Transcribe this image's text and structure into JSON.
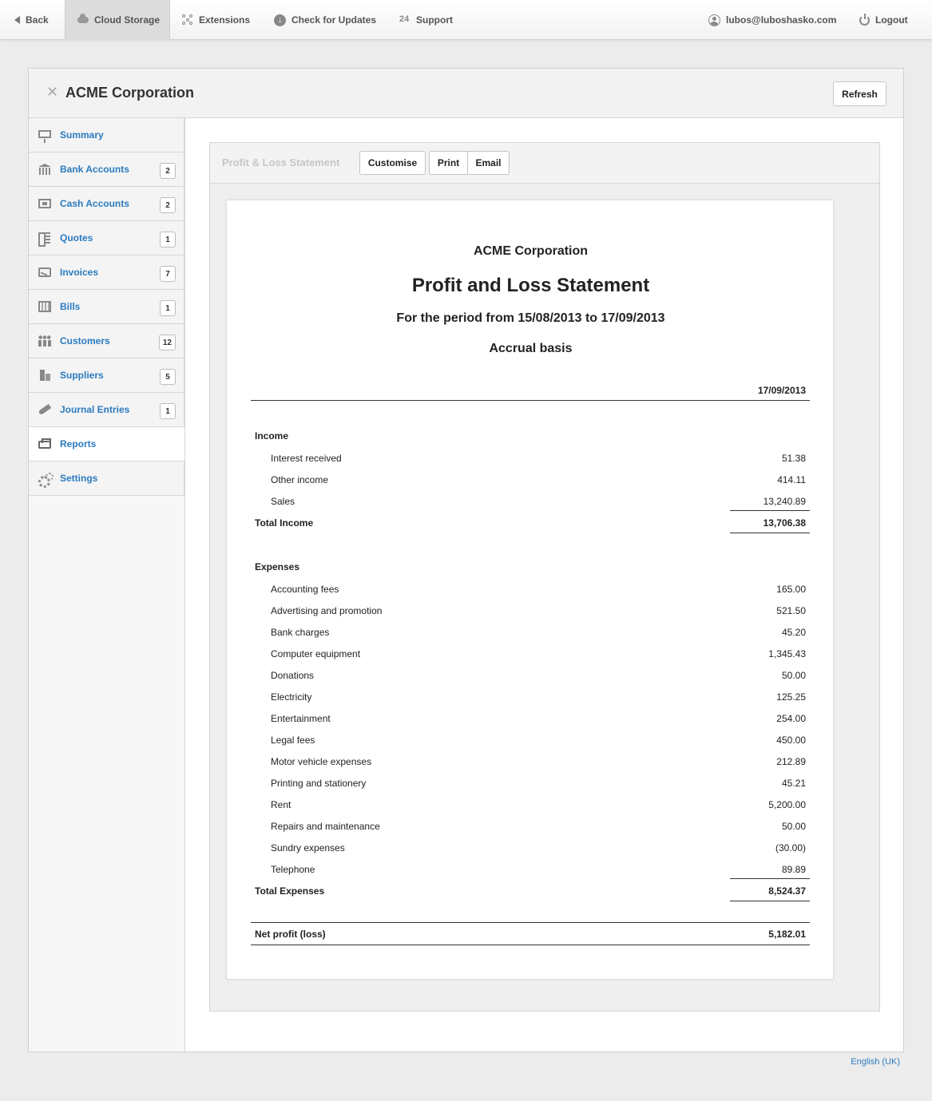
{
  "topbar": {
    "back": "Back",
    "cloud_storage": "Cloud Storage",
    "extensions": "Extensions",
    "check_updates": "Check for Updates",
    "support": "Support",
    "support_icon_text": "24",
    "user": "lubos@luboshasko.com",
    "logout": "Logout"
  },
  "header": {
    "company": "ACME Corporation",
    "close": "✕",
    "refresh": "Refresh"
  },
  "sidebar": {
    "items": [
      {
        "label": "Summary",
        "badge": null,
        "icon": "summary-icon"
      },
      {
        "label": "Bank Accounts",
        "badge": "2",
        "icon": "bank-icon"
      },
      {
        "label": "Cash Accounts",
        "badge": "2",
        "icon": "cash-register-icon"
      },
      {
        "label": "Quotes",
        "badge": "1",
        "icon": "quotes-icon"
      },
      {
        "label": "Invoices",
        "badge": "7",
        "icon": "invoice-icon"
      },
      {
        "label": "Bills",
        "badge": "1",
        "icon": "calendar-icon"
      },
      {
        "label": "Customers",
        "badge": "12",
        "icon": "people-icon"
      },
      {
        "label": "Suppliers",
        "badge": "5",
        "icon": "building-icon"
      },
      {
        "label": "Journal Entries",
        "badge": "1",
        "icon": "quill-icon"
      },
      {
        "label": "Reports",
        "badge": null,
        "icon": "printer-icon"
      },
      {
        "label": "Settings",
        "badge": null,
        "icon": "gears-icon"
      }
    ],
    "active": "Reports"
  },
  "report_toolbar": {
    "breadcrumb": "Profit & Loss Statement",
    "customise": "Customise",
    "print": "Print",
    "email": "Email"
  },
  "report": {
    "company": "ACME Corporation",
    "title": "Profit and Loss Statement",
    "period": "For the period from 15/08/2013 to 17/09/2013",
    "basis": "Accrual basis",
    "column_date": "17/09/2013",
    "income": {
      "heading": "Income",
      "lines": [
        {
          "label": "Interest received",
          "amount": "51.38"
        },
        {
          "label": "Other income",
          "amount": "414.11"
        },
        {
          "label": "Sales",
          "amount": "13,240.89"
        }
      ],
      "total_label": "Total Income",
      "total": "13,706.38"
    },
    "expenses": {
      "heading": "Expenses",
      "lines": [
        {
          "label": "Accounting fees",
          "amount": "165.00"
        },
        {
          "label": "Advertising and promotion",
          "amount": "521.50"
        },
        {
          "label": "Bank charges",
          "amount": "45.20"
        },
        {
          "label": "Computer equipment",
          "amount": "1,345.43"
        },
        {
          "label": "Donations",
          "amount": "50.00"
        },
        {
          "label": "Electricity",
          "amount": "125.25"
        },
        {
          "label": "Entertainment",
          "amount": "254.00"
        },
        {
          "label": "Legal fees",
          "amount": "450.00"
        },
        {
          "label": "Motor vehicle expenses",
          "amount": "212.89"
        },
        {
          "label": "Printing and stationery",
          "amount": "45.21"
        },
        {
          "label": "Rent",
          "amount": "5,200.00"
        },
        {
          "label": "Repairs and maintenance",
          "amount": "50.00"
        },
        {
          "label": "Sundry expenses",
          "amount": "(30.00)"
        },
        {
          "label": "Telephone",
          "amount": "89.89"
        }
      ],
      "total_label": "Total Expenses",
      "total": "8,524.37"
    },
    "net_label": "Net profit (loss)",
    "net": "5,182.01"
  },
  "footer": {
    "language": "English (UK)"
  }
}
